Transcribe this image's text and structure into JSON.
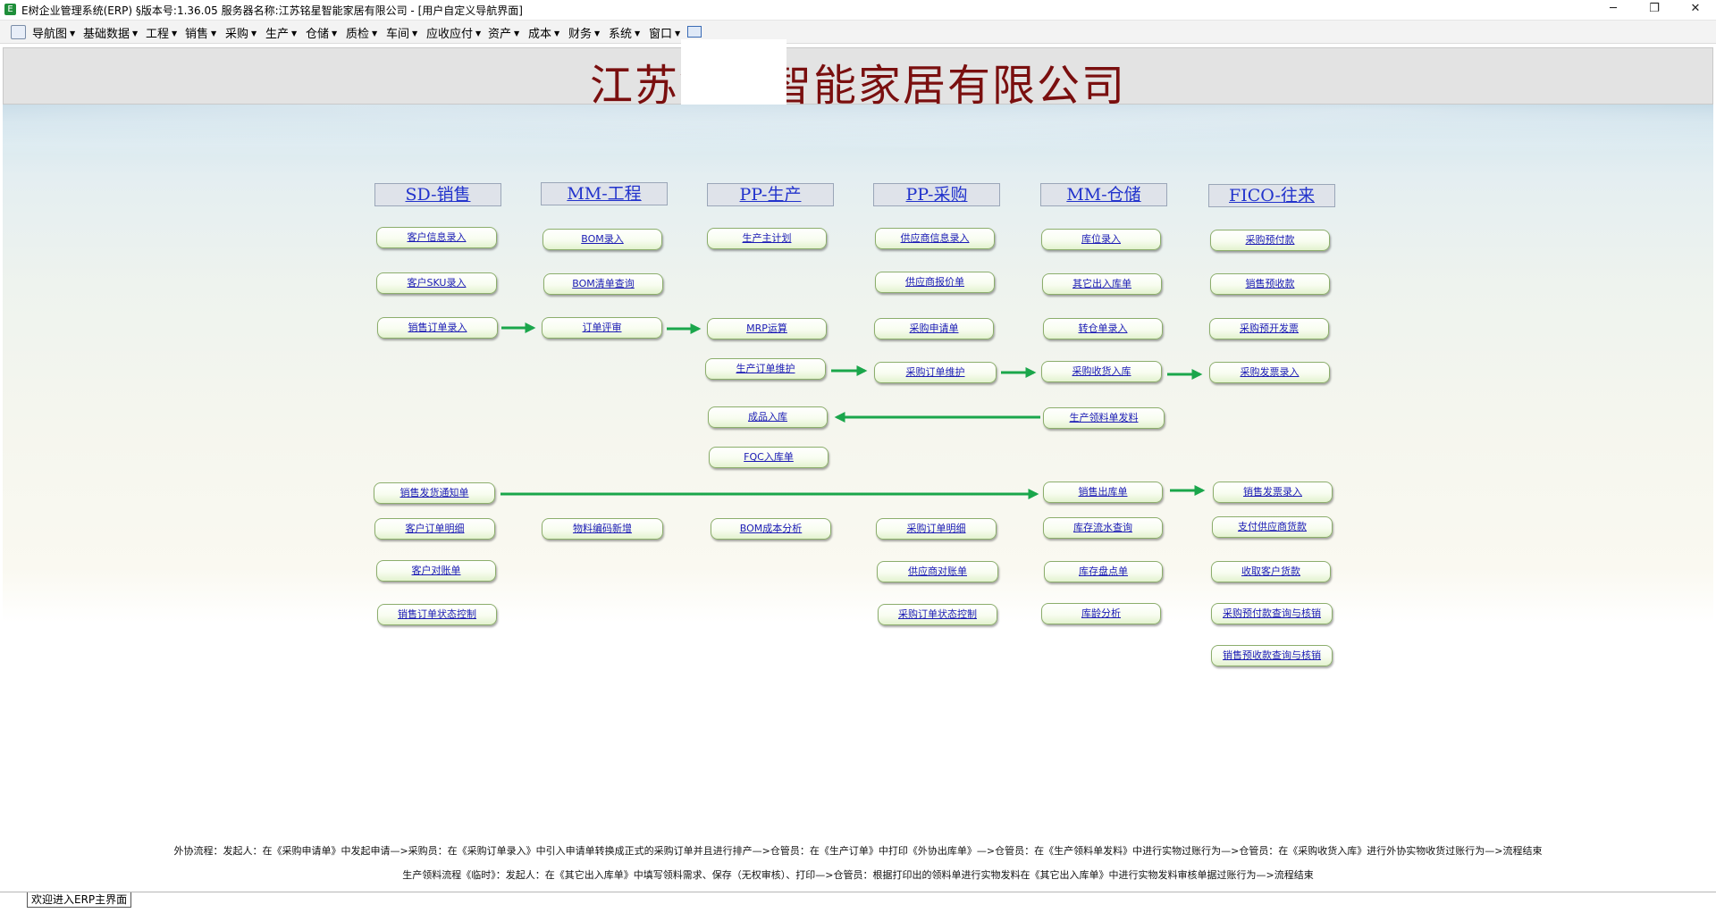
{
  "window": {
    "title": "E树企业管理系统(ERP) §版本号:1.36.05  服务器名称:江苏铭星智能家居有限公司 - [用户自定义导航界面]",
    "minimize": "─",
    "restore": "❐",
    "close": "✕"
  },
  "menu": {
    "items": [
      "导航图",
      "基础数据",
      "工程",
      "销售",
      "采购",
      "生产",
      "仓储",
      "质检",
      "车间",
      "应收应付",
      "资产",
      "成本",
      "财务",
      "系统",
      "窗口"
    ]
  },
  "banner": {
    "company": "江苏铭星智能家居有限公司"
  },
  "columns": [
    "SD-销售",
    "MM-工程",
    "PP-生产",
    "PP-采购",
    "MM-仓储",
    "FICO-往来"
  ],
  "nodes": {
    "sd": [
      "客户信息录入",
      "客户SKU录入",
      "销售订单录入",
      "销售发货通知单",
      "客户订单明细",
      "客户对账单",
      "销售订单状态控制"
    ],
    "mm_eng": [
      "BOM录入",
      "BOM清单查询",
      "订单评审",
      "物料编码新增"
    ],
    "pp_prod": [
      "生产主计划",
      "MRP运算",
      "生产订单维护",
      "成品入库",
      "FQC入库单",
      "BOM成本分析"
    ],
    "pp_purch": [
      "供应商信息录入",
      "供应商报价单",
      "采购申请单",
      "采购订单维护",
      "采购订单明细",
      "供应商对账单",
      "采购订单状态控制"
    ],
    "mm_wh": [
      "库位录入",
      "其它出入库单",
      "转仓单录入",
      "采购收货入库",
      "生产领料单发料",
      "销售出库单",
      "库存流水查询",
      "库存盘点单",
      "库龄分析"
    ],
    "fico": [
      "采购预付款",
      "销售预收款",
      "采购预开发票",
      "采购发票录入",
      "销售发票录入",
      "支付供应商货款",
      "收取客户货款",
      "采购预付款查询与核销",
      "销售预收款查询与核销"
    ]
  },
  "flows": {
    "outsourcing": "外协流程：发起人：在《采购申请单》中发起申请—>采购员：在《采购订单录入》中引入申请单转换成正式的采购订单并且进行排产—>仓管员：在《生产订单》中打印《外协出库单》—>仓管员：在《生产领料单发料》中进行实物过账行为—>仓管员：在《采购收货入库》进行外协实物收货过账行为—>流程结束",
    "temp_pick": "生产领料流程《临时》：发起人：在《其它出入库单》中填写领料需求、保存（无权审核）、打印—>仓管员：根据打印出的领料单进行实物发料在《其它出入库单》中进行实物发料审核单据过账行为—>流程结束"
  },
  "tabs": {
    "active": "欢迎进入ERP主界面"
  },
  "colors": {
    "accent_arrow": "#1aa64b",
    "link": "#1a1ab5",
    "company": "#7a0f0f"
  }
}
